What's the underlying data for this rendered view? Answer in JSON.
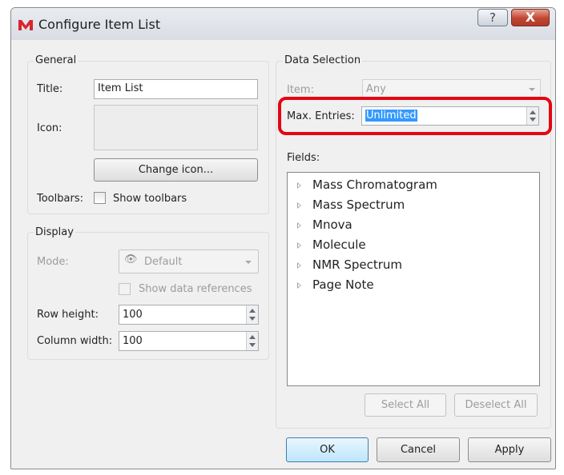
{
  "window": {
    "title": "Configure Item List",
    "help_label": "?",
    "close_label": "X"
  },
  "general": {
    "legend": "General",
    "title_label": "Title:",
    "title_value": "Item List",
    "icon_label": "Icon:",
    "change_icon_label": "Change icon...",
    "toolbars_label": "Toolbars:",
    "show_toolbars_label": "Show toolbars",
    "show_toolbars_checked": false
  },
  "display": {
    "legend": "Display",
    "mode_label": "Mode:",
    "mode_value": "Default",
    "show_refs_label": "Show data references",
    "show_refs_checked": false,
    "row_height_label": "Row height:",
    "row_height_value": "100",
    "column_width_label": "Column width:",
    "column_width_value": "100"
  },
  "data_selection": {
    "legend": "Data Selection",
    "item_label": "Item:",
    "item_value": "Any",
    "max_entries_label": "Max. Entries:",
    "max_entries_value": "Unlimited",
    "fields_label": "Fields:",
    "fields": [
      {
        "label": "Mass Chromatogram"
      },
      {
        "label": "Mass Spectrum"
      },
      {
        "label": "Mnova"
      },
      {
        "label": "Molecule"
      },
      {
        "label": "NMR Spectrum"
      },
      {
        "label": "Page Note"
      }
    ],
    "select_all_label": "Select All",
    "deselect_all_label": "Deselect All"
  },
  "footer": {
    "ok_label": "OK",
    "cancel_label": "Cancel",
    "apply_label": "Apply"
  },
  "colors": {
    "highlight": "#e30613",
    "selection": "#3399ff",
    "close_button": "#c14532"
  }
}
